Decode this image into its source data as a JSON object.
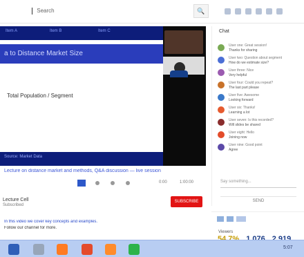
{
  "browser": {
    "search_text": "Search",
    "search_button": "🔍",
    "top_icons": [
      "grid-icon",
      "bell-icon",
      "bookmark-icon",
      "menu-icon",
      "settings-icon",
      "more-icon"
    ]
  },
  "video": {
    "slide_header_labels": [
      "Item A",
      "Item B",
      "Item C"
    ],
    "slide_title": "a to Distance Market Size",
    "slide_body_text": "Total Population / Segment",
    "slide_footer_text": "Source: Market Data",
    "video_title": "Lecture on distance market and methods, Q&A discussion — live session",
    "controls_labels": [
      "0:00",
      "1:00:00"
    ]
  },
  "channel": {
    "name": "Lecture Cell",
    "subtext": "Subscribed",
    "subscribe_button": "SUBSCRIBE"
  },
  "description": {
    "line1": "In this video we cover key concepts and examples.",
    "line2": "Follow our channel for more."
  },
  "chat": {
    "title": "Chat",
    "items": [
      {
        "line1": "User one: Great session!",
        "line2": "Thanks for sharing"
      },
      {
        "line1": "User two: Question about segment",
        "line2": "How do we estimate size?"
      },
      {
        "line1": "User three: Nice",
        "line2": "Very helpful"
      },
      {
        "line1": "User four: Could you repeat?",
        "line2": "The last part please"
      },
      {
        "line1": "User five: Awesome",
        "line2": "Looking forward"
      },
      {
        "line1": "User six: Thanks!",
        "line2": "Learning a lot"
      },
      {
        "line1": "User seven: Is this recorded?",
        "line2": "Will slides be shared"
      },
      {
        "line1": "User eight: Hello",
        "line2": "Joining now"
      },
      {
        "line1": "User nine: Good point",
        "line2": "Agree"
      }
    ],
    "input_placeholder": "Say something...",
    "send_label": "SEND"
  },
  "mini": {
    "label": "Viewers"
  },
  "stocks": {
    "values": [
      "54.7%",
      "1,076",
      "2,919"
    ]
  },
  "taskbar": {
    "time_label": "5:07"
  }
}
